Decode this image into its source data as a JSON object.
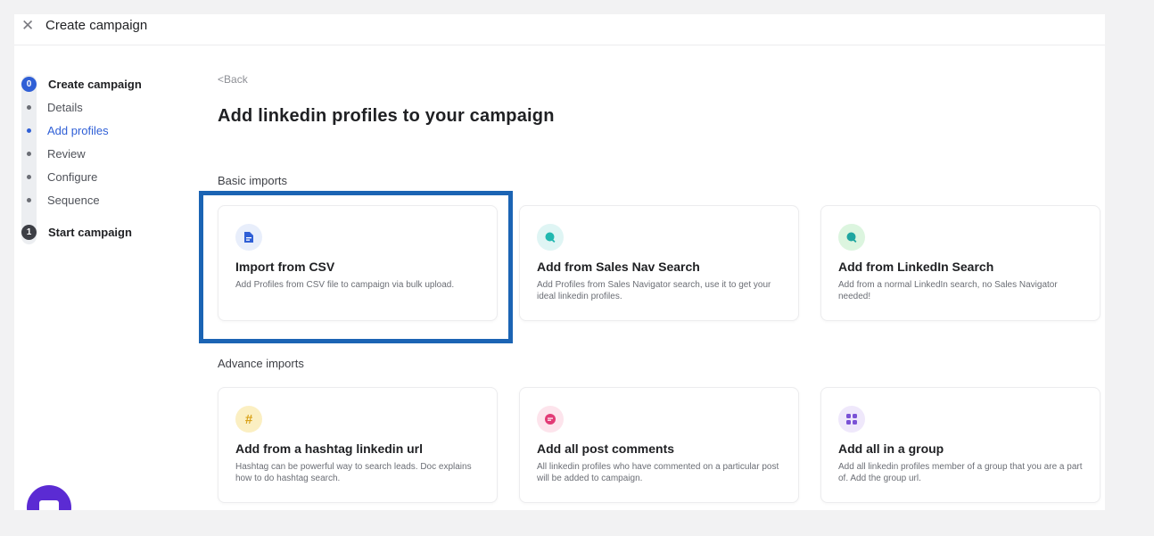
{
  "window": {
    "title": "Create campaign"
  },
  "stepper": {
    "steps": [
      {
        "number": "0",
        "label": "Create campaign"
      },
      {
        "number": "1",
        "label": "Start campaign"
      }
    ],
    "substeps": [
      "Details",
      "Add profiles",
      "Review",
      "Configure",
      "Sequence"
    ],
    "active_substep": "Add profiles",
    "active_color": "#2f5fd6"
  },
  "main": {
    "back_label": "Back",
    "heading": "Add linkedin profiles to your campaign",
    "basic_label": "Basic imports",
    "advance_label": "Advance imports",
    "basic_cards": [
      {
        "icon": "document-icon",
        "title": "Import from CSV",
        "desc": "Add Profiles from CSV file to campaign via bulk upload."
      },
      {
        "icon": "search-icon",
        "title": "Add from Sales Nav Search",
        "desc": "Add Profiles from Sales Navigator search, use it to get your ideal linkedin profiles."
      },
      {
        "icon": "search-icon",
        "title": "Add from LinkedIn Search",
        "desc": "Add from a normal LinkedIn search, no Sales Navigator needed!"
      }
    ],
    "advance_cards": [
      {
        "icon": "hashtag-icon",
        "title": "Add from a hashtag linkedin url",
        "desc": "Hashtag can be powerful way to search leads. Doc explains how to do hashtag search."
      },
      {
        "icon": "comment-icon",
        "title": "Add all post comments",
        "desc": "All linkedin profiles who have commented on a particular post will be added to campaign."
      },
      {
        "icon": "group-icon",
        "title": "Add all in a group",
        "desc": "Add all linkedin profiles member of a group that you are a part of. Add the group url."
      }
    ],
    "highlight_color": "#1b64b4"
  }
}
